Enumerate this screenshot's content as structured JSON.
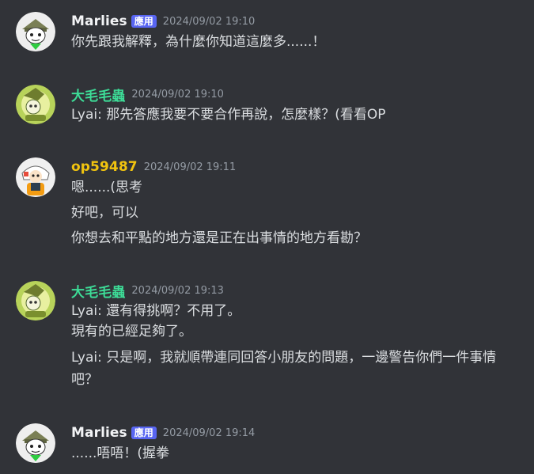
{
  "messages": [
    {
      "username": "Marlies",
      "username_color": "#f2f3f5",
      "badge": "應用",
      "timestamp": "2024/09/02 19:10",
      "lines": [
        "你先跟我解釋，為什麼你知道這麼多......！"
      ]
    },
    {
      "username": "大毛毛蟲",
      "username_color": "#3ddc97",
      "timestamp": "2024/09/02 19:10",
      "lines": [
        "Lyai: 那先答應我要不要合作再說，怎麼樣？(看看OP"
      ]
    },
    {
      "username": "op59487",
      "username_color": "#f1c40f",
      "timestamp": "2024/09/02 19:11",
      "lines": [
        "嗯......(思考",
        "好吧，可以",
        "你想去和平點的地方還是正在出事情的地方看勘？"
      ]
    },
    {
      "username": "大毛毛蟲",
      "username_color": "#3ddc97",
      "timestamp": "2024/09/02 19:13",
      "lines": [
        "Lyai: 還有得挑啊？不用了。",
        "現有的已經足夠了。",
        "Lyai: 只是啊，我就順帶連同回答小朋友的問題，一邊警告你們一件事情吧？"
      ]
    },
    {
      "username": "Marlies",
      "username_color": "#f2f3f5",
      "badge": "應用",
      "timestamp": "2024/09/02 19:14",
      "lines": [
        "......唔唔！(握拳"
      ]
    }
  ]
}
